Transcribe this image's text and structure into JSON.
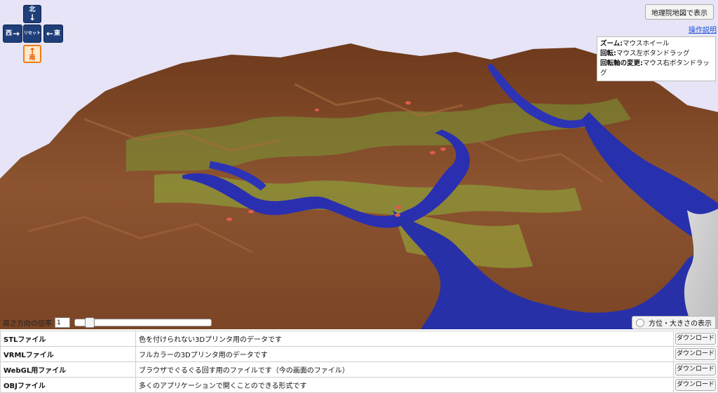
{
  "compass": {
    "north": "北",
    "west": "西",
    "east": "東",
    "south": "南",
    "reset": "リセット"
  },
  "header": {
    "gsi_button": "地理院地図で表示",
    "help_link": "操作説明"
  },
  "controls_help": [
    {
      "key": "ズーム:",
      "value": "マウスホイール"
    },
    {
      "key": "回転:",
      "value": "マウス左ボタンドラッグ"
    },
    {
      "key": "回転軸の変更:",
      "value": "マウス右ボタンドラッグ"
    }
  ],
  "height_control": {
    "label": "高さ方向の倍率",
    "value": "1",
    "slider_fraction": 0.08
  },
  "orientation_toggle": {
    "label": "方位・大きさの表示"
  },
  "downloads": [
    {
      "type": "STLファイル",
      "description": "色を付けられない3Dプリンタ用のデータです",
      "button": "ダウンロード"
    },
    {
      "type": "VRMLファイル",
      "description": "フルカラーの3Dプリンタ用のデータです",
      "button": "ダウンロード"
    },
    {
      "type": "WebGL用ファイル",
      "description": "ブラウザでぐるぐる回す用のファイルです（今の画面のファイル）",
      "button": "ダウンロード"
    },
    {
      "type": "OBJファイル",
      "description": "多くのアプリケーションで開くことのできる形式です",
      "button": "ダウンロード"
    }
  ],
  "colors": {
    "sky": "#e6e4f6",
    "mountain": "#8a4f2a",
    "vegetation": "#7fa43a",
    "lowland": "#2a2fb0",
    "accent_south": "#f07d18"
  }
}
